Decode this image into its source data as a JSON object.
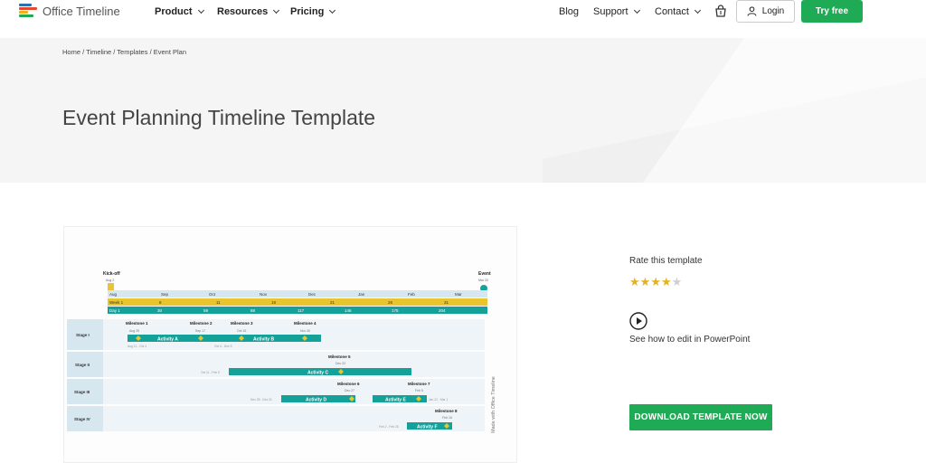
{
  "header": {
    "logo_text": "Office Timeline",
    "nav": [
      {
        "label": "Product"
      },
      {
        "label": "Resources"
      },
      {
        "label": "Pricing"
      }
    ],
    "blog_label": "Blog",
    "support_label": "Support",
    "contact_label": "Contact",
    "login_label": "Login",
    "try_label": "Try free"
  },
  "hero": {
    "breadcrumb": "Home / Timeline / Templates / Event Plan",
    "title": "Event Planning Timeline Template"
  },
  "side_panel": {
    "rate_label": "Rate this template",
    "rating": 4,
    "rating_max": 5,
    "edit_link": "See how to edit in PowerPoint",
    "download_label": "DOWNLOAD TEMPLATE NOW"
  },
  "timeline_preview": {
    "kickoff": {
      "label": "Kick-off",
      "date": "Aug 2"
    },
    "event": {
      "label": "Event",
      "date": "Mar 20"
    },
    "months": [
      "Aug",
      "Sep",
      "Oct",
      "Nov",
      "Dec",
      "Jan",
      "Feb",
      "Mar"
    ],
    "weeks": [
      "Week 1",
      "8",
      "11",
      "18",
      "21",
      "26",
      "31"
    ],
    "days": [
      "Day 1",
      "30",
      "59",
      "88",
      "117",
      "146",
      "175",
      "204"
    ],
    "stages": [
      "Stage I",
      "Stage II",
      "Stage III",
      "Stage IV"
    ],
    "milestones": [
      {
        "label": "Milestone 1",
        "date": "Aug 25"
      },
      {
        "label": "Milestone 2",
        "date": "Sep 17"
      },
      {
        "label": "Milestone 3",
        "date": "Oct 15"
      },
      {
        "label": "Milestone 4",
        "date": "Nov 30"
      },
      {
        "label": "Milestone 5",
        "date": "Dec 22"
      },
      {
        "label": "Milestone 6",
        "date": "Dec 27"
      },
      {
        "label": "Milestone 7",
        "date": "Feb 6"
      },
      {
        "label": "Milestone 8",
        "date": "Feb 16"
      }
    ],
    "activities": [
      {
        "label": "Activity A",
        "range": "Aug 11 - Oct 4"
      },
      {
        "label": "Activity B",
        "range": "Oct 4 - Dec 5"
      },
      {
        "label": "Activity C",
        "range": "Oct 11 - Feb 9"
      },
      {
        "label": "Activity D",
        "range": "Nov 28 - Dec 31"
      },
      {
        "label": "Activity E",
        "range": "Jan 22 - Mar 1"
      },
      {
        "label": "Activity F",
        "range": "Feb 2 - Feb 28"
      }
    ],
    "watermark": "Made with Office Timeline"
  },
  "colors": {
    "brand_green": "#1fab55",
    "timeline_teal": "#14a19a",
    "timeline_yellow": "#e8c52e",
    "month_band": "#d6e7ef",
    "star_gold": "#e6b21c",
    "star_empty": "#cfcfcf"
  },
  "icons": {
    "cart": "shopping-bag-icon",
    "login": "user-icon",
    "play": "play-circle-icon"
  }
}
